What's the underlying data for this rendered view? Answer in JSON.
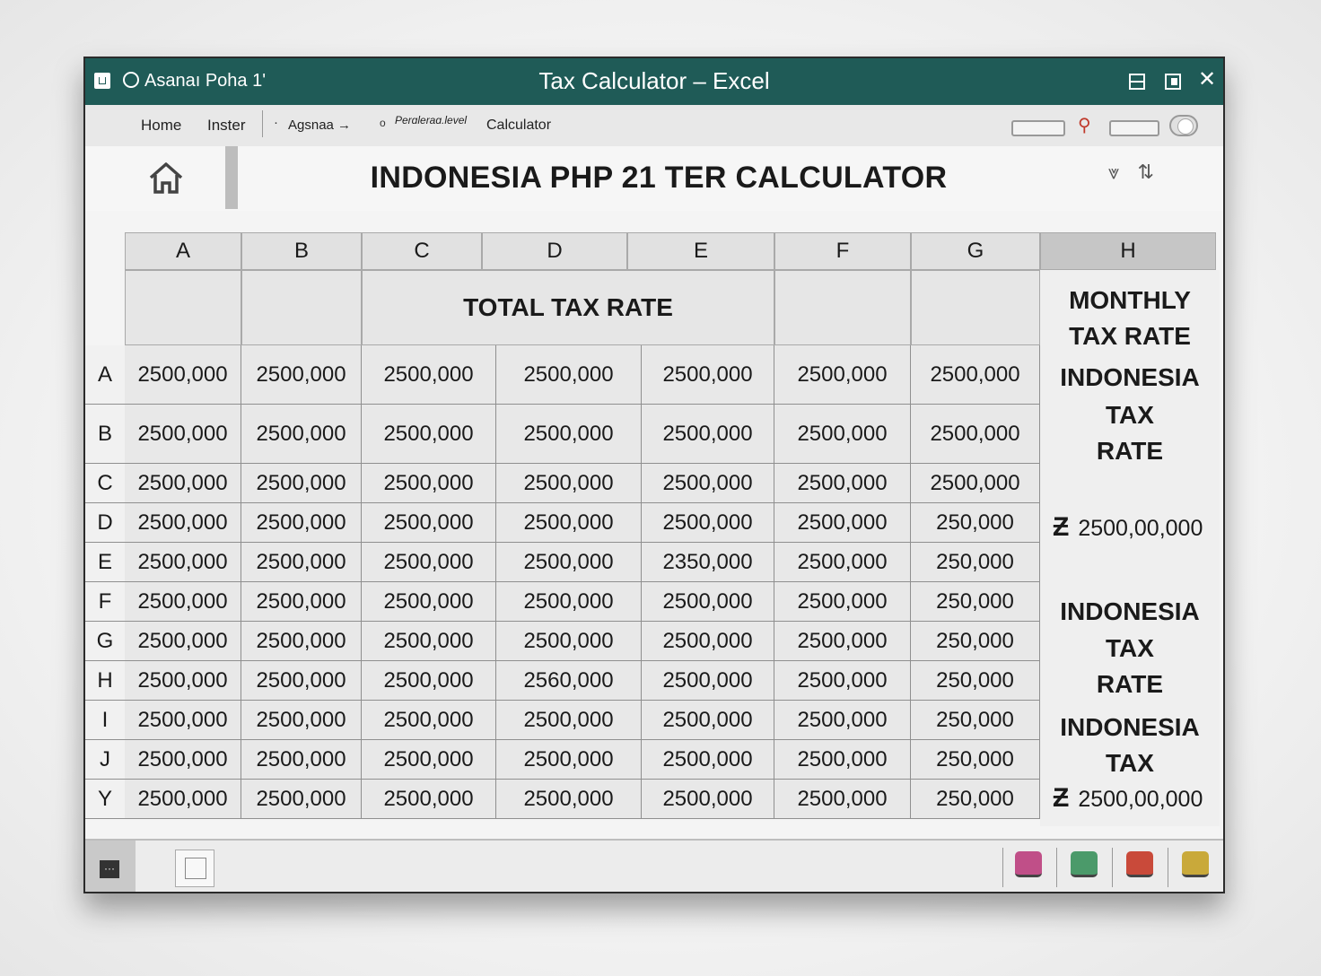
{
  "titlebar": {
    "account": "Asanaı Poha 1'",
    "title": "Tax Calculator  –  Excel"
  },
  "ribbon": {
    "tabs": [
      "Home",
      "Inster",
      "Agsnaa →",
      "Perɑleraɑ.level",
      "Calculator"
    ]
  },
  "header": {
    "title": "INDONESIA PHP 21 TER CALCULATOR"
  },
  "grid": {
    "columns": [
      "A",
      "B",
      "C",
      "D",
      "E",
      "F",
      "G",
      "H"
    ],
    "band_title": "TOTAL TAX RATE",
    "rows": [
      {
        "label": "A",
        "cells": [
          "2500,000",
          "2500,000",
          "2500,000",
          "2500,000",
          "2500,000",
          "2500,000",
          "2500,000"
        ]
      },
      {
        "label": "B",
        "cells": [
          "2500,000",
          "2500,000",
          "2500,000",
          "2500,000",
          "2500,000",
          "2500,000",
          "2500,000"
        ]
      },
      {
        "label": "C",
        "cells": [
          "2500,000",
          "2500,000",
          "2500,000",
          "2500,000",
          "2500,000",
          "2500,000",
          "2500,000"
        ]
      },
      {
        "label": "D",
        "cells": [
          "2500,000",
          "2500,000",
          "2500,000",
          "2500,000",
          "2500,000",
          "2500,000",
          "250,000"
        ]
      },
      {
        "label": "E",
        "cells": [
          "2500,000",
          "2500,000",
          "2500,000",
          "2500,000",
          "2350,000",
          "2500,000",
          "250,000"
        ]
      },
      {
        "label": "F",
        "cells": [
          "2500,000",
          "2500,000",
          "2500,000",
          "2500,000",
          "2500,000",
          "2500,000",
          "250,000"
        ]
      },
      {
        "label": "G",
        "cells": [
          "2500,000",
          "2500,000",
          "2500,000",
          "2500,000",
          "2500,000",
          "2500,000",
          "250,000"
        ]
      },
      {
        "label": "H",
        "cells": [
          "2500,000",
          "2500,000",
          "2500,000",
          "2560,000",
          "2500,000",
          "2500,000",
          "250,000"
        ]
      },
      {
        "label": "I",
        "cells": [
          "2500,000",
          "2500,000",
          "2500,000",
          "2500,000",
          "2500,000",
          "2500,000",
          "250,000"
        ]
      },
      {
        "label": "J",
        "cells": [
          "2500,000",
          "2500,000",
          "2500,000",
          "2500,000",
          "2500,000",
          "2500,000",
          "250,000"
        ]
      },
      {
        "label": "Y",
        "cells": [
          "2500,000",
          "2500,000",
          "2500,000",
          "2500,000",
          "2500,000",
          "2500,000",
          "250,000"
        ]
      }
    ]
  },
  "side_panel": {
    "l1": "MONTHLY",
    "l2": "TAX RATE",
    "l3": "INDONESIA",
    "l4": "TAX",
    "l5": "RATE",
    "value1_symbol": "Ƶ",
    "value1": "2500,00,000",
    "l6": "INDONESIA",
    "l7": "TAX",
    "l8": "RATE",
    "l9": "INDONESIA",
    "l10": "TAX",
    "value2_symbol": "Ƶ",
    "value2": "2500,00,000"
  },
  "colors": {
    "titlebar": "#1f5b57",
    "grid_cell": "#e8e8e8",
    "header_h": "#c6c6c6"
  },
  "statusbar": {
    "icons": [
      "paint-app-icon",
      "finance-app-icon",
      "presentation-app-icon",
      "coins-app-icon"
    ]
  }
}
